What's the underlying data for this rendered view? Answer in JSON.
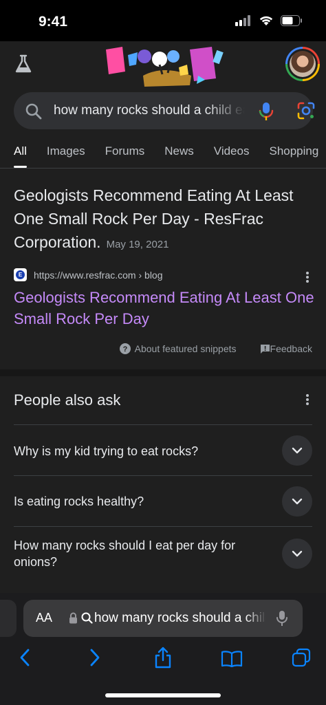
{
  "status_bar": {
    "time": "9:41"
  },
  "header": {
    "labs_icon": "flask-icon",
    "doodle": "google-doodle",
    "avatar": "profile-avatar"
  },
  "search": {
    "query": "how many rocks should a child eat",
    "icons": [
      "search-icon",
      "microphone-icon",
      "google-lens-icon"
    ]
  },
  "tabs": [
    {
      "label": "All",
      "active": true
    },
    {
      "label": "Images"
    },
    {
      "label": "Forums"
    },
    {
      "label": "News"
    },
    {
      "label": "Videos"
    },
    {
      "label": "Shopping"
    }
  ],
  "featured_snippet": {
    "title": "Geologists Recommend Eating At Least One Small Rock Per Day - ResFrac Corporation.",
    "date": "May 19, 2021",
    "source_url": "https://www.resfrac.com › blog",
    "link_text": "Geologists Recommend Eating At Least One Small Rock Per Day",
    "about_label": "About featured snippets",
    "feedback_label": "Feedback"
  },
  "people_also_ask": {
    "title": "People also ask",
    "questions": [
      "Why is my kid trying to eat rocks?",
      "Is eating rocks healthy?",
      "How many rocks should I eat per day for onions?"
    ]
  },
  "safari": {
    "text_size_label": "AA",
    "address_text": "how many rocks should a child eat",
    "toolbar": [
      "back-icon",
      "forward-icon",
      "share-icon",
      "bookmarks-icon",
      "tabs-icon"
    ],
    "accent_color": "#0a84ff"
  }
}
